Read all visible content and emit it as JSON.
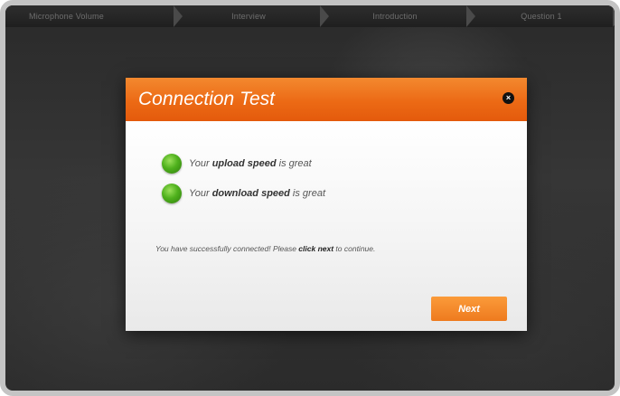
{
  "progress_steps": [
    "Microphone Volume",
    "Interview",
    "Introduction",
    "Question 1"
  ],
  "dialog": {
    "title": "Connection Test",
    "close_glyph": "×",
    "upload": {
      "pre": "Your ",
      "strong": "upload speed",
      "post": " is great"
    },
    "download": {
      "pre": "Your ",
      "strong": "download speed",
      "post": " is great"
    },
    "message": {
      "pre": "You have successfully connected! Please ",
      "strong": "click next",
      "post": " to continue."
    },
    "next_label": "Next"
  },
  "colors": {
    "accent_orange": "#ec6a15",
    "status_green": "#4fb11d"
  },
  "icons": {
    "status_indicator": "green-dot-icon",
    "close": "close-icon",
    "step_separator": "chevron-right-icon"
  }
}
